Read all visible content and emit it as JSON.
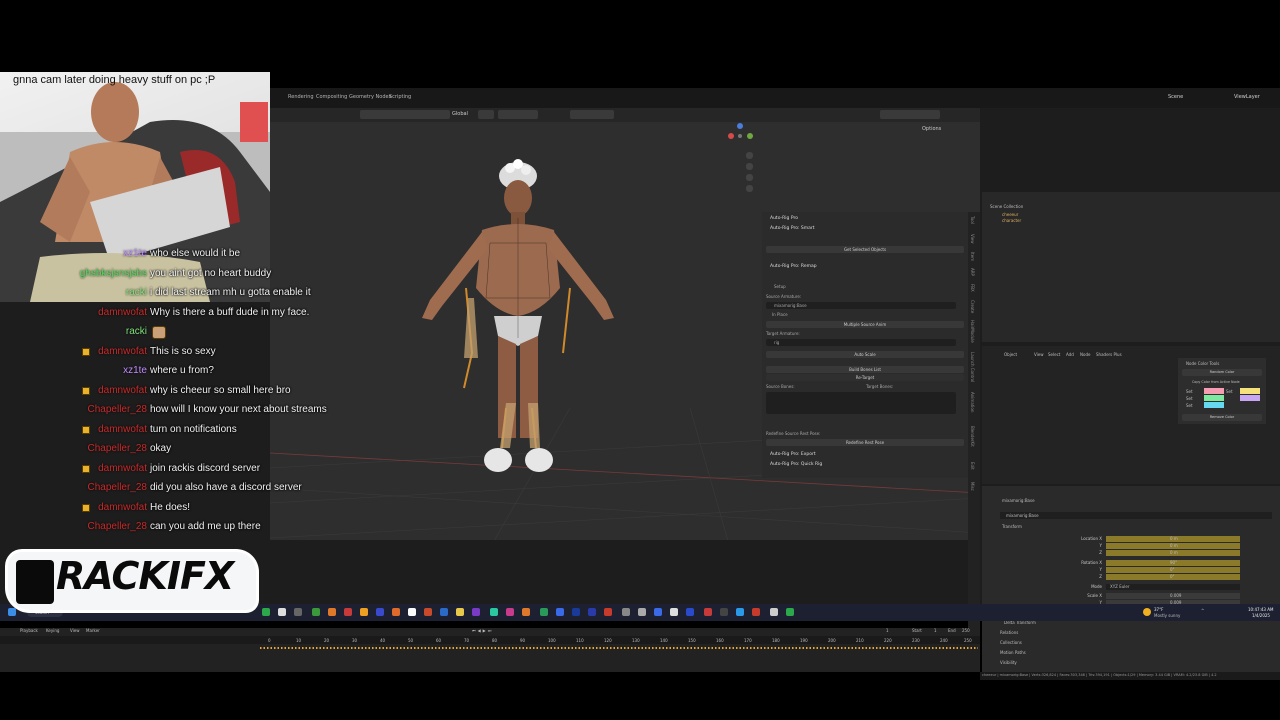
{
  "cam_caption": "gnna cam later doing heavy stuff on pc ;P",
  "chat": [
    {
      "user": "xz1te",
      "color": "#c08cff",
      "msg": "who else would it be",
      "crown": false,
      "emote": false
    },
    {
      "user": "ghsbksjsnsjsbs",
      "color": "#4fd65a",
      "msg": "you aint got no heart buddy",
      "crown": false,
      "emote": false
    },
    {
      "user": "racki",
      "color": "#7fe07a",
      "msg": "i did last stream mh u gotta enable it",
      "crown": false,
      "emote": false
    },
    {
      "user": "damnwofat",
      "color": "#c92a2a",
      "msg": "Why is there a buff dude in my face.",
      "crown": false,
      "emote": false
    },
    {
      "user": "racki",
      "color": "#7fe07a",
      "msg": "",
      "crown": false,
      "emote": true
    },
    {
      "user": "damnwofat",
      "color": "#c92a2a",
      "msg": "This is so sexy",
      "crown": true,
      "emote": false
    },
    {
      "user": "xz1te",
      "color": "#c08cff",
      "msg": "where u from?",
      "crown": false,
      "emote": false
    },
    {
      "user": "damnwofat",
      "color": "#c92a2a",
      "msg": "why is cheeur so small here bro",
      "crown": true,
      "emote": false
    },
    {
      "user": "Chapeller_28",
      "color": "#c92a2a",
      "msg": "how will I know your next about streams",
      "crown": false,
      "emote": false
    },
    {
      "user": "damnwofat",
      "color": "#c92a2a",
      "msg": "turn on notifications",
      "crown": true,
      "emote": false
    },
    {
      "user": "Chapeller_28",
      "color": "#c92a2a",
      "msg": "okay",
      "crown": false,
      "emote": false
    },
    {
      "user": "damnwofat",
      "color": "#c92a2a",
      "msg": "join rackis discord server",
      "crown": true,
      "emote": false
    },
    {
      "user": "Chapeller_28",
      "color": "#c92a2a",
      "msg": "did you also have a discord server",
      "crown": false,
      "emote": false
    },
    {
      "user": "damnwofat",
      "color": "#c92a2a",
      "msg": "He does!",
      "crown": true,
      "emote": false
    },
    {
      "user": "Chapeller_28",
      "color": "#c92a2a",
      "msg": "can you add me up there",
      "crown": false,
      "emote": false
    }
  ],
  "logo": {
    "text": "RACKIFX"
  },
  "blender": {
    "workspace_tabs": [
      "Rendering",
      "Compositing",
      "Geometry Nodes",
      "Scripting"
    ],
    "scene_label": "Scene",
    "viewlayer_label": "ViewLayer",
    "viewport": {
      "orientation": "Global",
      "options": "Options"
    },
    "npanel": {
      "title": "Auto-Rig Pro",
      "smart": "Auto-Rig Pro: Smart",
      "get_selected": "Get Selected Objects",
      "remap": "Auto-Rig Pro: Remap",
      "setup": "Setup",
      "source_armature": "Source Armature:",
      "source_value": "mixamorig:Base",
      "in_place": "In Place",
      "multiple_source": "Multiple Source Anim",
      "target_armature": "Target Armature:",
      "target_value": "rig",
      "auto_scale": "Auto Scale",
      "build_bones": "Build Bones List",
      "re_target": "Re-Target",
      "source_bones": "Source Bones:",
      "target_bones": "Target Bones:",
      "redefine": "Redefine Source Rest Pose:",
      "redefine_btn": "Redefine Rest Pose",
      "export": "Auto-Rig Pro: Export",
      "quick_rig": "Auto-Rig Pro: Quick Rig"
    },
    "side_tabs": [
      "Tool",
      "View",
      "Item",
      "ARP",
      "FBX",
      "Create",
      "HairModule",
      "Launch Control",
      "Animation",
      "BlenderKit",
      "Edit",
      "Misc"
    ],
    "outliner": {
      "collection": "Scene Collection",
      "items": [
        "cheeeur",
        "character"
      ]
    },
    "shader": {
      "menus": [
        "Object",
        "View",
        "Select",
        "Add",
        "Node",
        "Shaders Plus"
      ],
      "tools_title": "Node Color Tools",
      "random_color": "Random Color",
      "copy_color": "Copy Color from Active Node",
      "set": "Set",
      "remove_color": "Remove Color"
    },
    "props": {
      "object_name": "mixamorig:Base",
      "transform": "Transform",
      "location": "Location X",
      "rotation": "Rotation X",
      "mode_label": "Mode",
      "mode_value": "XYZ Euler",
      "scale": "Scale X",
      "axis_y": "Y",
      "axis_z": "Z",
      "loc_values": [
        "0 m",
        "0 m",
        "0 m"
      ],
      "rot_values": [
        "90°",
        "0°",
        "0°"
      ],
      "scale_values": [
        "0.009",
        "0.009",
        "0.009"
      ],
      "sections": [
        "Delta Transform",
        "Relations",
        "Collections",
        "Motion Paths",
        "Visibility"
      ]
    },
    "timeline": {
      "menus": [
        "Playback",
        "Keying",
        "View",
        "Marker"
      ],
      "current_frame": "1",
      "start_label": "Start",
      "start": "1",
      "end_label": "End",
      "end": "250",
      "ticks": [
        "0",
        "10",
        "20",
        "30",
        "40",
        "50",
        "60",
        "70",
        "80",
        "90",
        "100",
        "110",
        "120",
        "130",
        "140",
        "150",
        "160",
        "170",
        "180",
        "190",
        "200",
        "210",
        "220",
        "230",
        "240",
        "250"
      ]
    },
    "status_text": "cheeeur | mixamorig:Base | Verts:326,824 | Faces:303,346 | Tris:394,191 | Objects:1/29 | Memory: 3.44 GiB | VRAM: 4.2/23.8 GiB | 4.2"
  },
  "taskbar": {
    "search": "Search",
    "weather_temp": "37°F",
    "weather_desc": "Mostly sunny",
    "time": "10:47:43 AM",
    "date": "1/4/2025"
  },
  "colors": {
    "crown": "#e8b22c",
    "accent_orange": "#e8a838",
    "blender_bg": "#1d1d1d"
  }
}
